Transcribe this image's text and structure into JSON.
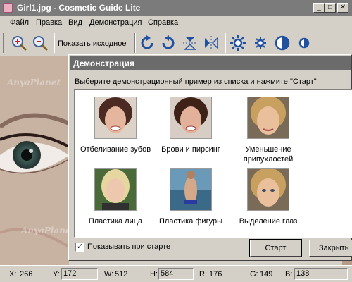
{
  "window": {
    "title": "Girl1.jpg - Cosmetic Guide Lite",
    "min": "_",
    "max": "□",
    "close": "✕"
  },
  "menu": [
    "Файл",
    "Правка",
    "Вид",
    "Демонстрация",
    "Справка"
  ],
  "toolbar": {
    "show_original": "Показать исходное",
    "icons": [
      "zoom-in-icon",
      "zoom-out-icon",
      "rotate-cw-icon",
      "rotate-ccw-icon",
      "flip-vertical-icon",
      "flip-horizontal-icon",
      "brightness-icon",
      "brightness-small-icon",
      "contrast-icon",
      "contrast-small-icon"
    ]
  },
  "dialog": {
    "title": "Демонстрация",
    "instruction": "Выберите демонстрационный пример из списка и нажмите \"Старт\"",
    "items": [
      {
        "label": "Отбеливание зубов"
      },
      {
        "label": "Брови и пирсинг"
      },
      {
        "label": "Уменьшение припухлостей"
      },
      {
        "label": "Пластика лица"
      },
      {
        "label": "Пластика фигуры"
      },
      {
        "label": "Выделение глаз"
      }
    ],
    "show_at_start": "Показывать при старте",
    "show_at_start_checked": true,
    "start_button": "Старт",
    "close_button": "Закрыть"
  },
  "status": {
    "x_label": "X:",
    "x_value": "266",
    "y_label": "Y:",
    "y_value": "172",
    "w_label": "W:",
    "w_value": "512",
    "h_label": "H:",
    "h_value": "584",
    "r_label": "R:",
    "r_value": "176",
    "g_label": "G:",
    "g_value": "149",
    "b_label": "B:",
    "b_value": "138"
  },
  "watermark": "AnyaPlanet"
}
